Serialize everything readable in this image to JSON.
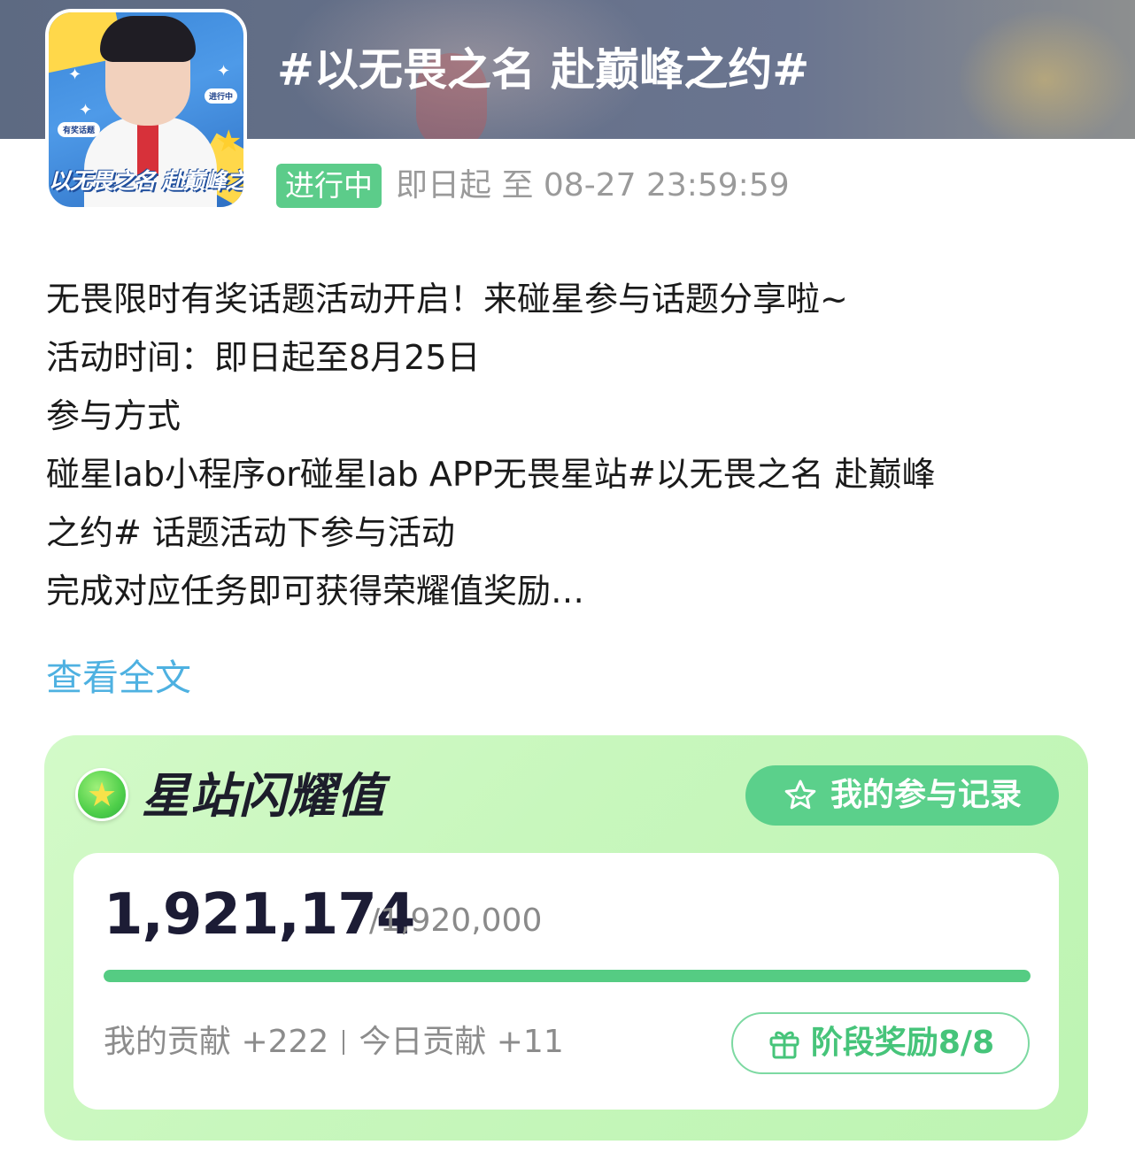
{
  "topic": {
    "title": "#以无畏之名 赴巅峰之约#",
    "status": "进行中",
    "date_range": "即日起 至 08-27 23:59:59"
  },
  "cover": {
    "badge_left": "有奖话题",
    "badge_right": "进行中",
    "script_text": "以无畏之名 赴巅峰之约"
  },
  "description": {
    "lines": [
      "无畏限时有奖话题活动开启！来碰星参与话题分享啦~",
      "活动时间：即日起至8月25日",
      "参与方式",
      "碰星lab小程序or碰星lab APP无畏星站#以无畏之名 赴巅峰",
      "之约# 话题活动下参与活动",
      "完成对应任务即可获得荣耀值奖励…"
    ],
    "read_more": "查看全文"
  },
  "honor": {
    "title": "星站闪耀值",
    "record_button": "我的参与记录",
    "current": "1,921,174",
    "target": "/1,920,000",
    "progress_fraction": 1.0,
    "my_contribution": "我的贡献 +222",
    "today_contribution": "今日贡献 +11",
    "stage_reward": "阶段奖励8/8"
  },
  "icons": {
    "record": "star-outline-icon",
    "stage": "gift-icon",
    "honor": "star-badge-icon"
  },
  "colors": {
    "accent_green": "#5bd08b",
    "link_blue": "#4eb1e1",
    "status_green": "#5ccc8a"
  }
}
